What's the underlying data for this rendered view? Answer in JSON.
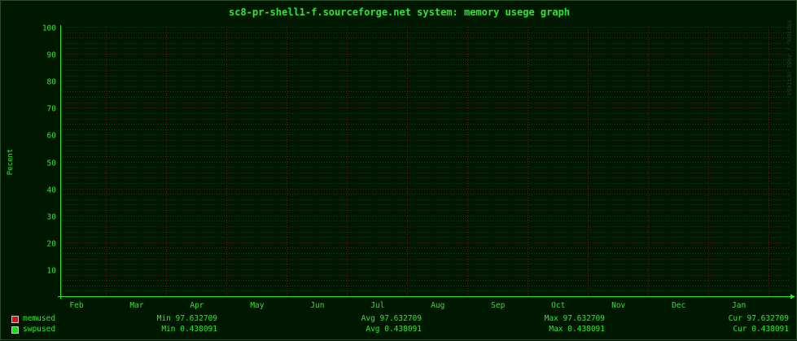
{
  "title": "sc8-pr-shell1-f.sourceforge.net system: memory usege graph",
  "ylabel": "Pecent",
  "watermark": "RRDTOOL / TOBI OETIKER",
  "colors": {
    "background": "#001800",
    "text": "#2ee62e",
    "grid_minor": "#3a2a1e",
    "grid_major": "#5a1a1a",
    "axis": "#2ee62e",
    "memused": "#e01010",
    "swpused": "#10e010"
  },
  "chart_data": {
    "type": "line",
    "title": "sc8-pr-shell1-f.sourceforge.net system: memory usege graph",
    "xlabel": "",
    "ylabel": "Pecent",
    "x_tick_labels": [
      "Feb",
      "Mar",
      "Apr",
      "May",
      "Jun",
      "Jul",
      "Aug",
      "Sep",
      "Oct",
      "Nov",
      "Dec",
      "Jan"
    ],
    "y_ticks": [
      10,
      20,
      30,
      40,
      50,
      60,
      70,
      80,
      90,
      100
    ],
    "ylim": [
      0,
      100
    ],
    "grid": true,
    "legend_position": "bottom",
    "series": [
      {
        "name": "memused",
        "color": "#e01010",
        "values": []
      },
      {
        "name": "swpused",
        "color": "#10e010",
        "values": []
      }
    ]
  },
  "legend": [
    {
      "name": "memused",
      "color": "#e01010",
      "min": "Min 97.632709",
      "avg": "Avg 97.632709",
      "max": "Max 97.632709",
      "cur": "Cur 97.632709"
    },
    {
      "name": "swpused",
      "color": "#10e010",
      "min": "Min 0.438091",
      "avg": "Avg 0.438091",
      "max": "Max 0.438091",
      "cur": "Cur 0.438091"
    }
  ]
}
